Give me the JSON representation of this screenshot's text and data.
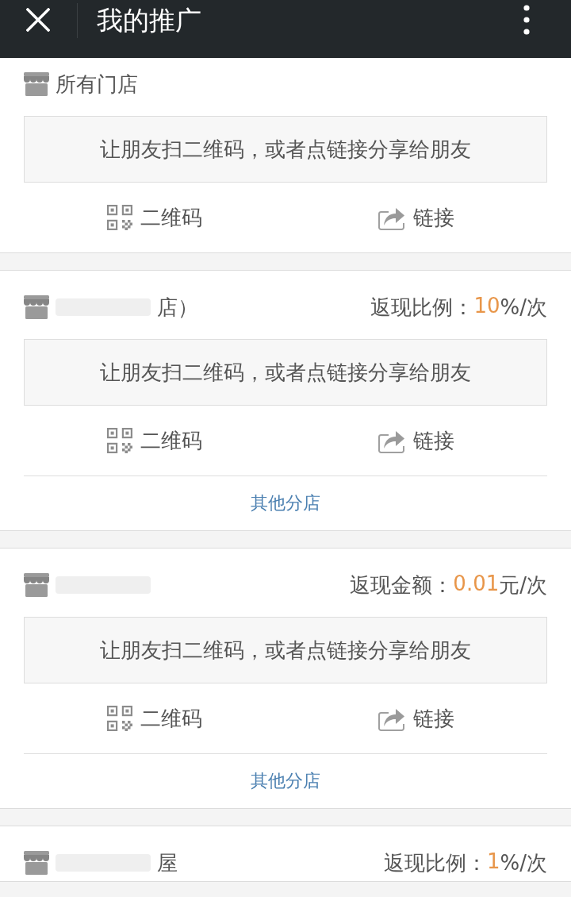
{
  "header": {
    "title": "我的推广"
  },
  "stores": [
    {
      "name": "所有门店",
      "redacted": false,
      "hint": "让朋友扫二维码，或者点链接分享给朋友",
      "actions": [
        {
          "kind": "qr",
          "label": "二维码"
        },
        {
          "kind": "share",
          "label": "链接"
        }
      ]
    },
    {
      "name": "店）",
      "redacted": true,
      "reward": {
        "label": "返现比例：",
        "value": "10",
        "unit": "%/次"
      },
      "hint": "让朋友扫二维码，或者点链接分享给朋友",
      "actions": [
        {
          "kind": "qr",
          "label": "二维码"
        },
        {
          "kind": "share",
          "label": "链接"
        }
      ],
      "footer_link": "其他分店"
    },
    {
      "redacted": true,
      "reward": {
        "label": "返现金额：",
        "value": "0.01",
        "unit": "元/次"
      },
      "hint": "让朋友扫二维码，或者点链接分享给朋友",
      "actions": [
        {
          "kind": "qr",
          "label": "二维码"
        },
        {
          "kind": "share",
          "label": "链接"
        }
      ],
      "footer_link": "其他分店"
    },
    {
      "name": "屋",
      "redacted": true,
      "reward": {
        "label": "返现比例：",
        "value": "1",
        "unit": "%/次"
      }
    }
  ]
}
